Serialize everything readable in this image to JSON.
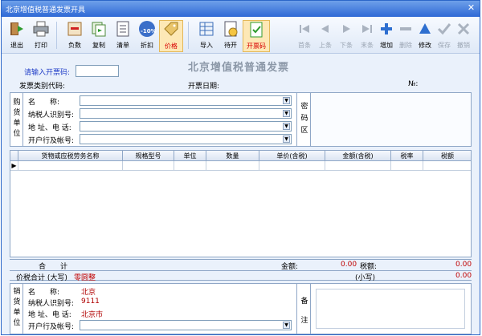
{
  "window": {
    "title": "北京增值税普通发票开具",
    "close_label": "✕"
  },
  "toolbar": {
    "buttons": [
      {
        "label": "退出"
      },
      {
        "label": "打印"
      },
      {
        "label": "负数"
      },
      {
        "label": "复制"
      },
      {
        "label": "清单"
      },
      {
        "label": "折扣"
      },
      {
        "label": "价格"
      },
      {
        "label": "导入"
      },
      {
        "label": "待开"
      },
      {
        "label": "开票码"
      },
      {
        "label": "首条"
      },
      {
        "label": "上条"
      },
      {
        "label": "下条"
      },
      {
        "label": "末条"
      },
      {
        "label": "增加"
      },
      {
        "label": "删除"
      },
      {
        "label": "修改"
      },
      {
        "label": "保存"
      },
      {
        "label": "撤销"
      }
    ],
    "discount_badge": "-10%"
  },
  "header": {
    "invoice_title": "北京增值税普通发票",
    "code_prompt": "请输入开票码:",
    "category_code_label": "发票类别代码:",
    "date_label": "开票日期:",
    "number_label": "№:"
  },
  "buyer": {
    "section_label": "购货单位",
    "name_label": "名　　称:",
    "tax_id_label": "纳税人识别号:",
    "address_label": "地 址、电 话:",
    "bank_label": "开户行及帐号:",
    "secret_label": "密码区"
  },
  "grid": {
    "columns": [
      "货物或应税劳务名称",
      "规格型号",
      "单位",
      "数量",
      "单价(含税)",
      "金额(含税)",
      "税率",
      "税额"
    ],
    "row_marker": "▶"
  },
  "totals": {
    "sum_label": "合　　计",
    "amount_label": "金额:",
    "amount_value": "0.00",
    "tax_label": "税额:",
    "tax_value": "0.00",
    "total_label": "价税合计 (大写)",
    "total_upper": "零圆整",
    "small_label": "(小写)",
    "small_value": "0.00"
  },
  "seller": {
    "section_label": "销货单位",
    "name_label": "名　　称:",
    "name_value": "北京",
    "tax_id_label": "纳税人识别号:",
    "tax_id_value": "9111",
    "address_label": "地 址、电 话:",
    "address_value": "北京市",
    "bank_label": "开户行及帐号:",
    "remark_label": "备注"
  },
  "colors": {
    "accent": "#2f69d6",
    "money": "#c00000",
    "link_blue": "#2340c8"
  }
}
